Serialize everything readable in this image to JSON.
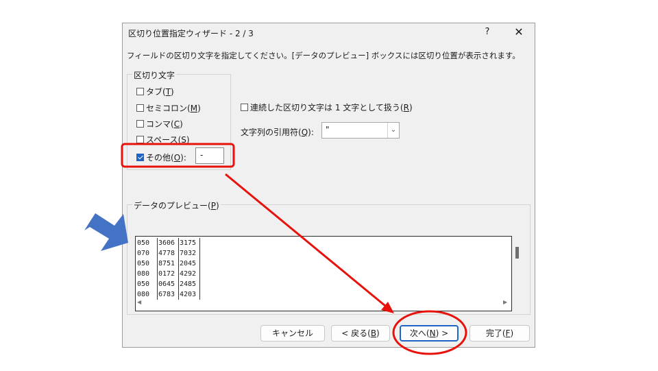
{
  "dialog": {
    "title": "区切り位置指定ウィザード - 2 / 3",
    "help_label": "?",
    "close_label": "✕",
    "instruction": "フィールドの区切り文字を指定してください。[データのプレビュー] ボックスには区切り位置が表示されます。"
  },
  "delimiters": {
    "legend": "区切り文字",
    "items": [
      {
        "label": "タブ",
        "key": "T",
        "checked": false
      },
      {
        "label": "セミコロン",
        "key": "M",
        "checked": false
      },
      {
        "label": "コンマ",
        "key": "C",
        "checked": false
      },
      {
        "label": "スペース",
        "key": "S",
        "checked": false
      },
      {
        "label": "その他",
        "key": "O",
        "checked": true
      }
    ],
    "other_suffix": ":",
    "other_value": "-"
  },
  "options": {
    "consecutive_label": "連続した区切り文字は 1 文字として扱う",
    "consecutive_key": "R",
    "consecutive_checked": false,
    "qualifier_label": "文字列の引用符",
    "qualifier_key": "Q",
    "qualifier_suffix": ":",
    "qualifier_value": "\""
  },
  "preview": {
    "legend": "データのプレビュー",
    "legend_key": "P",
    "rows": [
      [
        "050",
        "3606",
        "3175"
      ],
      [
        "070",
        "4778",
        "7032"
      ],
      [
        "050",
        "8751",
        "2045"
      ],
      [
        "080",
        "0172",
        "4292"
      ],
      [
        "050",
        "0645",
        "2485"
      ],
      [
        "080",
        "6783",
        "4203"
      ]
    ]
  },
  "buttons": {
    "cancel": "キャンセル",
    "back_prefix": "< 戻る",
    "back_key": "B",
    "next_prefix": "次へ",
    "next_key": "N",
    "next_suffix": " >",
    "finish_prefix": "完了",
    "finish_key": "F"
  },
  "annotation": {
    "highlight_color": "#e8120c",
    "pointer_arrow_color": "#4472c4"
  }
}
